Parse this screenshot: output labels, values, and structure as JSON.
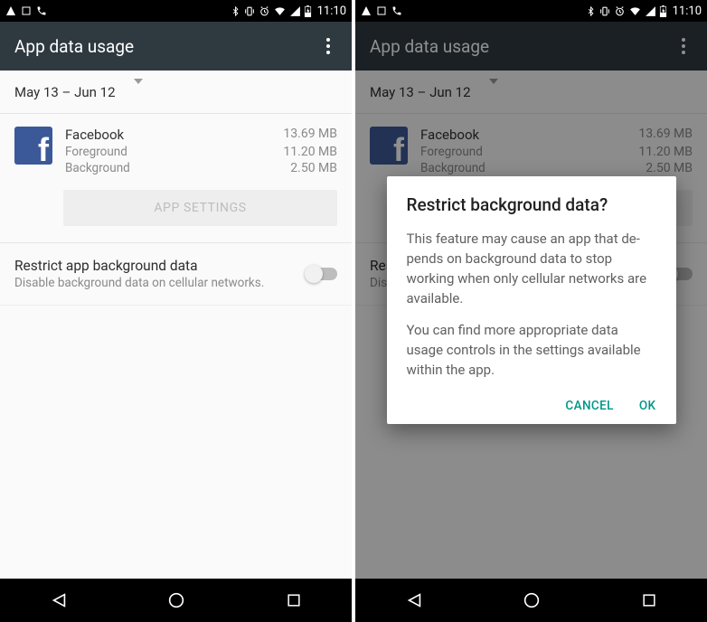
{
  "status": {
    "time": "11:10"
  },
  "appbar": {
    "title": "App data usage"
  },
  "dateRange": {
    "label": "May 13 – Jun 12"
  },
  "app": {
    "name": "Facebook",
    "totalSize": "13.69 MB",
    "foregroundLabel": "Foreground",
    "foregroundSize": "11.20 MB",
    "backgroundLabel": "Background",
    "backgroundSize": "2.50 MB"
  },
  "appSettingsLabel": "APP SETTINGS",
  "restrict": {
    "title": "Restrict app background data",
    "subtitle": "Disable background data on cellular networks."
  },
  "dialog": {
    "title": "Restrict background data?",
    "body1": "This feature may cause an app that de­pends on background data to stop working when only cellular networks are available.",
    "body2": "You can find more appropriate data usage controls in the settings available within the app.",
    "cancel": "CANCEL",
    "ok": "OK"
  }
}
